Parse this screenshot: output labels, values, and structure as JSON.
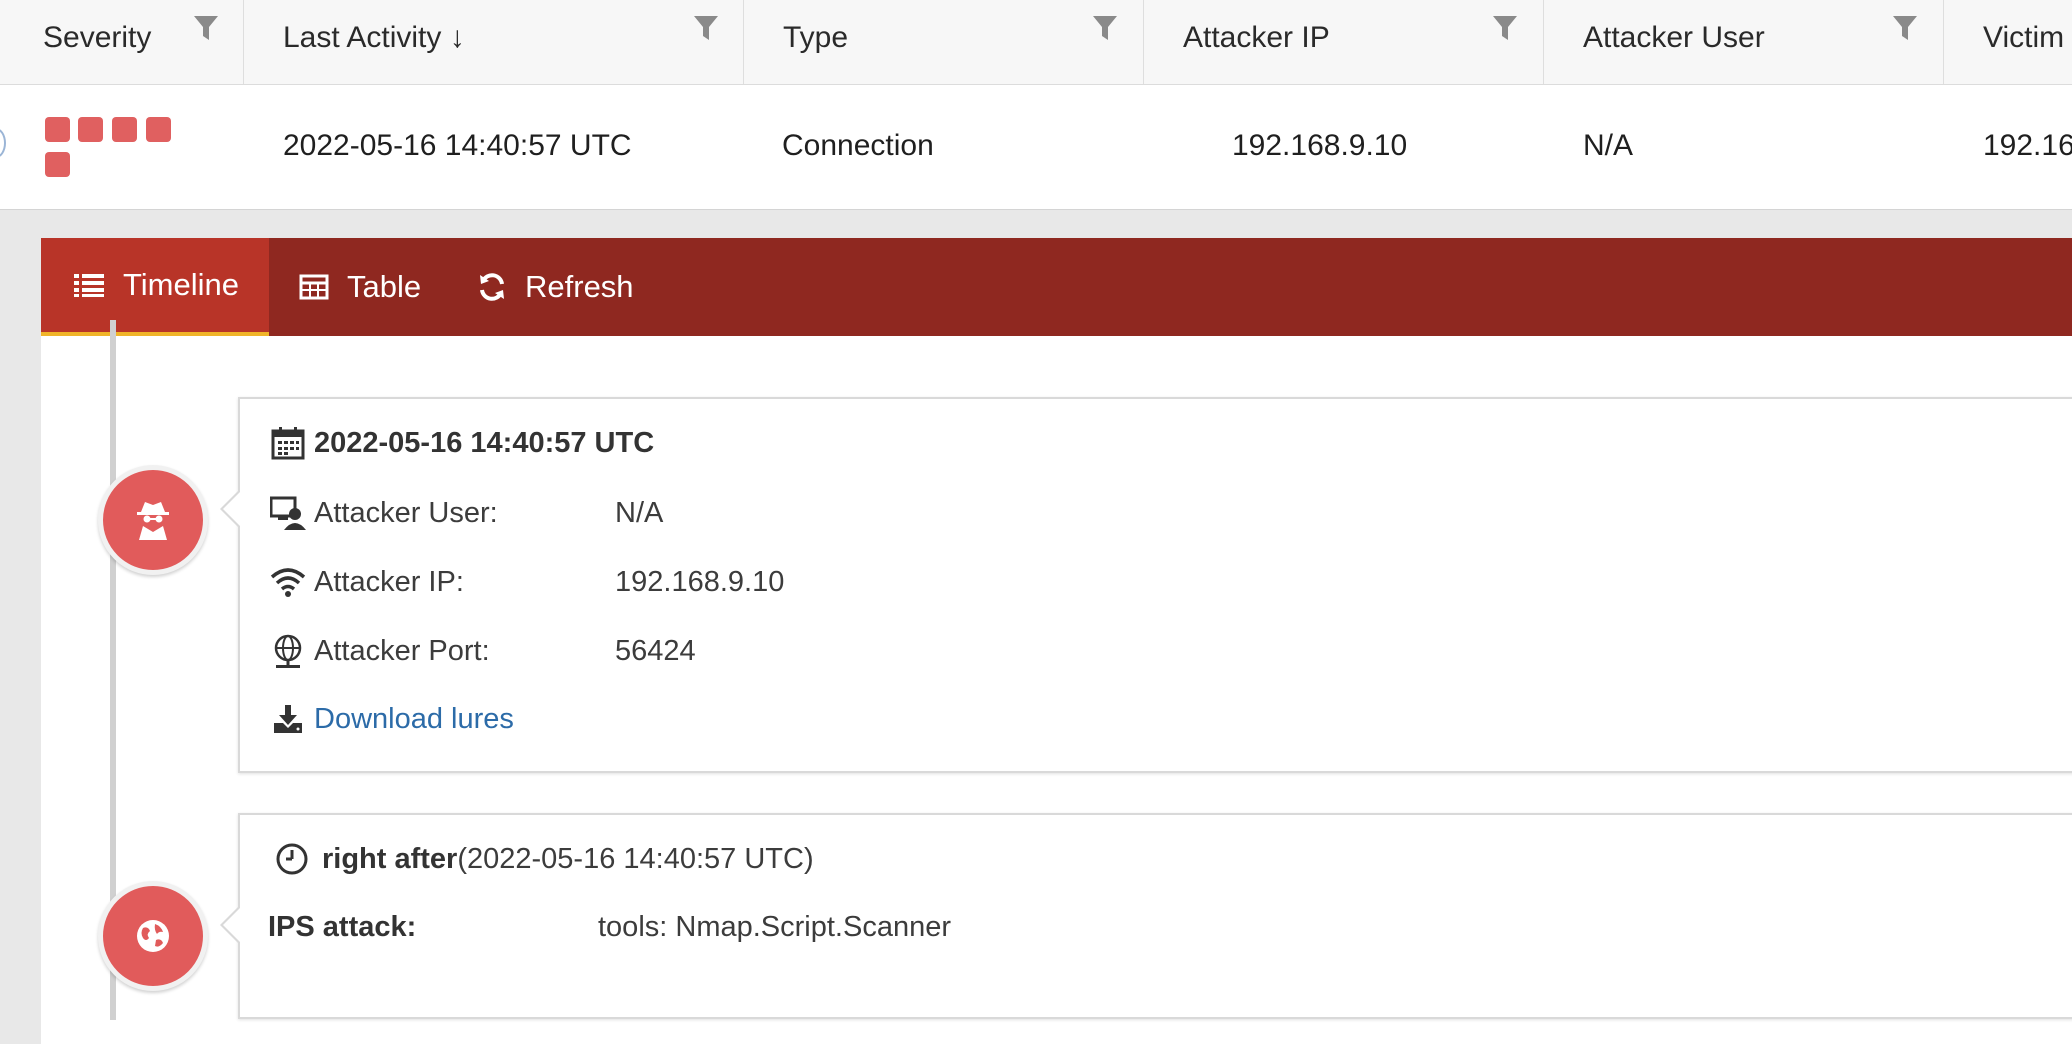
{
  "table": {
    "columns": [
      {
        "label": "Severity"
      },
      {
        "label": "Last Activity ↓"
      },
      {
        "label": "Type"
      },
      {
        "label": "Attacker IP"
      },
      {
        "label": "Attacker User"
      },
      {
        "label": "Victim"
      }
    ],
    "row": {
      "severity_level": 5,
      "last_activity": "2022-05-16 14:40:57 UTC",
      "type": "Connection",
      "attacker_ip": "192.168.9.10",
      "attacker_user": "N/A",
      "victim": "192.16"
    }
  },
  "toolbar": {
    "timeline_label": "Timeline",
    "table_label": "Table",
    "refresh_label": "Refresh"
  },
  "timeline": {
    "event1": {
      "timestamp": "2022-05-16 14:40:57 UTC",
      "attacker_user_label": "Attacker User:",
      "attacker_user_value": "N/A",
      "attacker_ip_label": "Attacker IP:",
      "attacker_ip_value": "192.168.9.10",
      "attacker_port_label": "Attacker Port:",
      "attacker_port_value": "56424",
      "download_label": "Download lures"
    },
    "event2": {
      "relative_label": "right after",
      "relative_time": "(2022-05-16 14:40:57 UTC)",
      "ips_label": "IPS attack:",
      "ips_value": "tools: Nmap.Script.Scanner"
    }
  },
  "colors": {
    "toolbar_bg": "#8f2820",
    "toolbar_active": "#b83428",
    "active_underline": "#f0b429",
    "severity": "#e06060",
    "timeline_dot": "#e15b5b",
    "link": "#2c6ba8"
  },
  "icons": {
    "filter": "filter-icon",
    "timeline": "list-icon",
    "table": "table-icon",
    "refresh": "refresh-icon",
    "event1_dot": "spy-icon",
    "event2_dot": "globe-icon"
  }
}
